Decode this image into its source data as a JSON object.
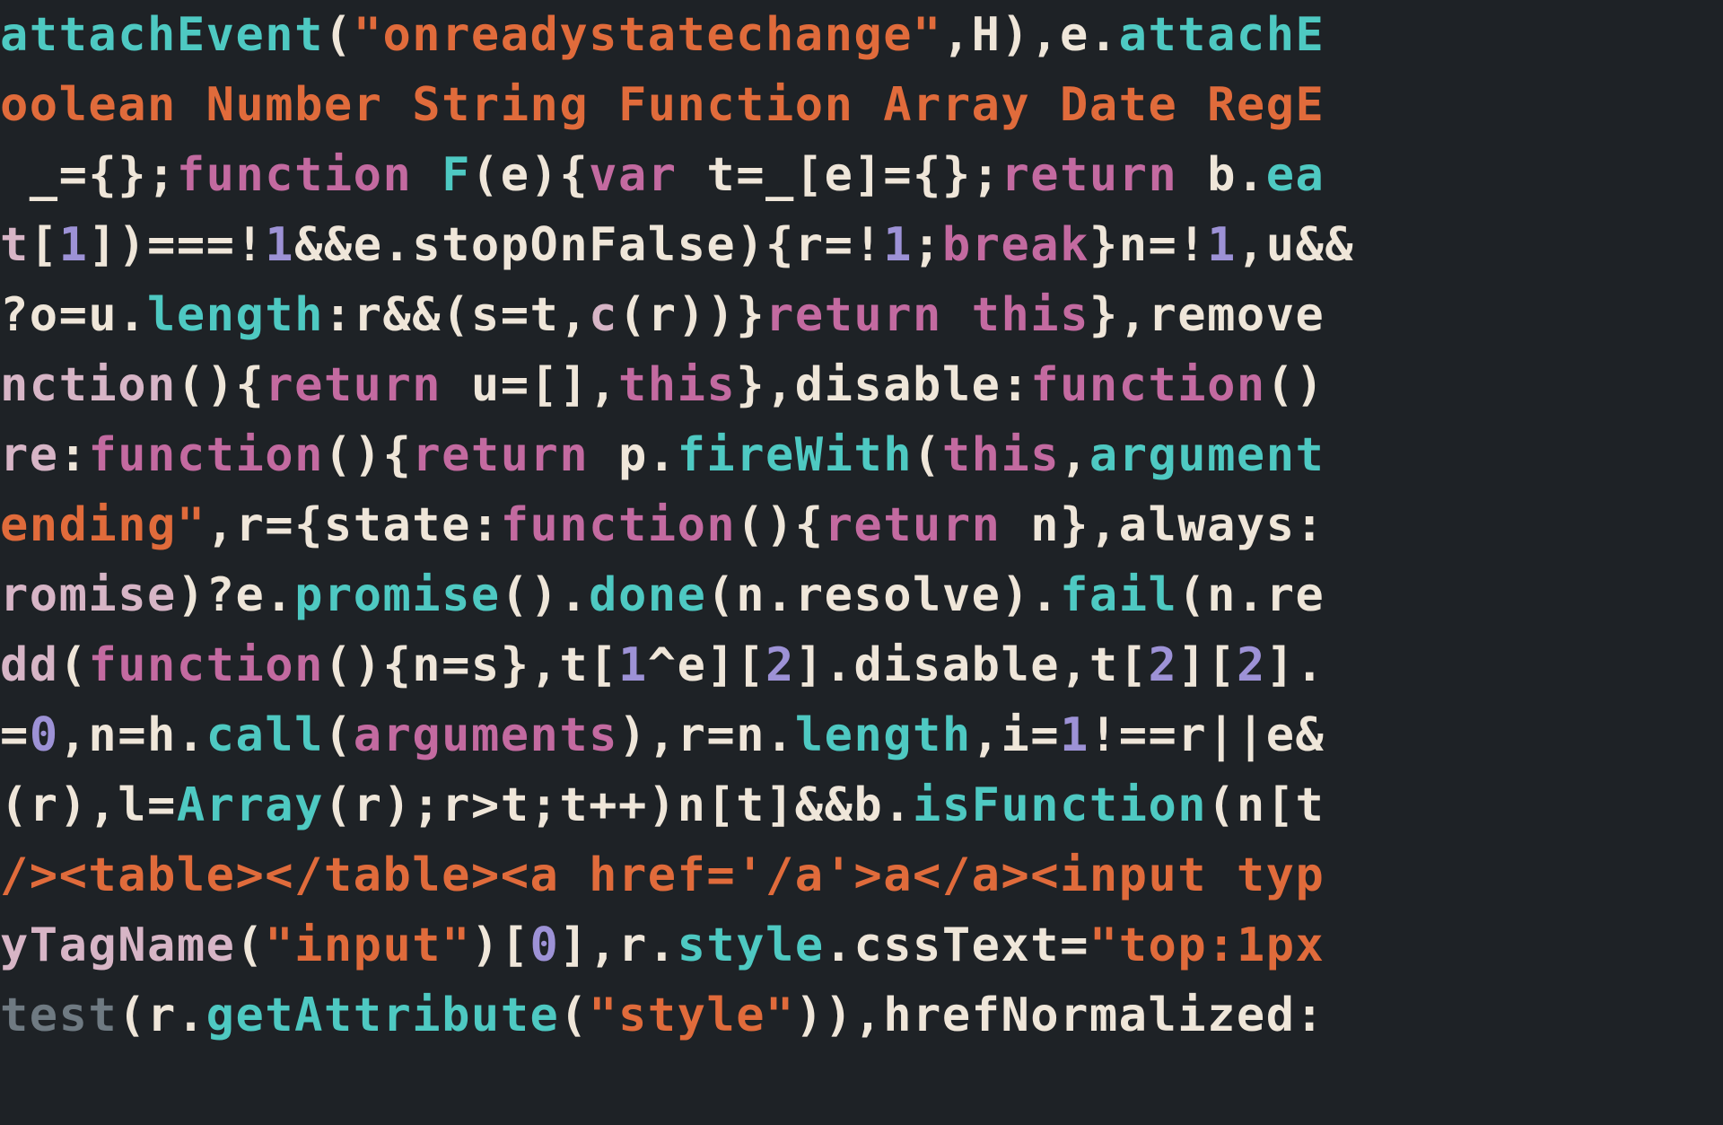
{
  "code": {
    "lines": [
      [
        {
          "c": "cyan",
          "t": "attachEvent"
        },
        {
          "c": "cream",
          "t": "("
        },
        {
          "c": "orange",
          "t": "\"onreadystatechange\""
        },
        {
          "c": "cream",
          "t": ",H),e."
        },
        {
          "c": "cyan",
          "t": "attachE"
        }
      ],
      [
        {
          "c": "orange",
          "t": "oolean Number String Function Array Date RegE"
        }
      ],
      [
        {
          "c": "cream",
          "t": " _={};"
        },
        {
          "c": "pink",
          "t": "function"
        },
        {
          "c": "cream",
          "t": " "
        },
        {
          "c": "cyan",
          "t": "F"
        },
        {
          "c": "cream",
          "t": "(e){"
        },
        {
          "c": "pink",
          "t": "var"
        },
        {
          "c": "cream",
          "t": " t=_[e]={};"
        },
        {
          "c": "pink",
          "t": "return"
        },
        {
          "c": "cream",
          "t": " b."
        },
        {
          "c": "cyan",
          "t": "ea"
        }
      ],
      [
        {
          "c": "mauve",
          "t": "t"
        },
        {
          "c": "cream",
          "t": "["
        },
        {
          "c": "purple",
          "t": "1"
        },
        {
          "c": "cream",
          "t": "])===!"
        },
        {
          "c": "purple",
          "t": "1"
        },
        {
          "c": "cream",
          "t": "&&e.stopOnFalse){r=!"
        },
        {
          "c": "purple",
          "t": "1"
        },
        {
          "c": "cream",
          "t": ";"
        },
        {
          "c": "pink",
          "t": "break"
        },
        {
          "c": "cream",
          "t": "}n=!"
        },
        {
          "c": "purple",
          "t": "1"
        },
        {
          "c": "cream",
          "t": ",u&&"
        }
      ],
      [
        {
          "c": "cream",
          "t": "?o=u."
        },
        {
          "c": "cyan",
          "t": "length"
        },
        {
          "c": "cream",
          "t": ":r&&(s=t,"
        },
        {
          "c": "mauve",
          "t": "c"
        },
        {
          "c": "cream",
          "t": "(r))}"
        },
        {
          "c": "pink",
          "t": "return this"
        },
        {
          "c": "cream",
          "t": "},remove"
        }
      ],
      [
        {
          "c": "mauve",
          "t": "nction"
        },
        {
          "c": "cream",
          "t": "(){"
        },
        {
          "c": "pink",
          "t": "return"
        },
        {
          "c": "cream",
          "t": " u=[],"
        },
        {
          "c": "pink",
          "t": "this"
        },
        {
          "c": "cream",
          "t": "},disable:"
        },
        {
          "c": "pink",
          "t": "function"
        },
        {
          "c": "cream",
          "t": "()"
        }
      ],
      [
        {
          "c": "mauve",
          "t": "re"
        },
        {
          "c": "cream",
          "t": ":"
        },
        {
          "c": "pink",
          "t": "function"
        },
        {
          "c": "cream",
          "t": "(){"
        },
        {
          "c": "pink",
          "t": "return"
        },
        {
          "c": "cream",
          "t": " p."
        },
        {
          "c": "cyan",
          "t": "fireWith"
        },
        {
          "c": "cream",
          "t": "("
        },
        {
          "c": "pink",
          "t": "this"
        },
        {
          "c": "cream",
          "t": ","
        },
        {
          "c": "cyan",
          "t": "argument"
        }
      ],
      [
        {
          "c": "orange",
          "t": "ending\""
        },
        {
          "c": "cream",
          "t": ",r={state:"
        },
        {
          "c": "pink",
          "t": "function"
        },
        {
          "c": "cream",
          "t": "(){"
        },
        {
          "c": "pink",
          "t": "return"
        },
        {
          "c": "cream",
          "t": " n},always:"
        }
      ],
      [
        {
          "c": "mauve",
          "t": "romise"
        },
        {
          "c": "cream",
          "t": ")?e."
        },
        {
          "c": "cyan",
          "t": "promise"
        },
        {
          "c": "cream",
          "t": "()."
        },
        {
          "c": "cyan",
          "t": "done"
        },
        {
          "c": "cream",
          "t": "(n.resolve)."
        },
        {
          "c": "cyan",
          "t": "fail"
        },
        {
          "c": "cream",
          "t": "(n.re"
        }
      ],
      [
        {
          "c": "mauve",
          "t": "dd"
        },
        {
          "c": "cream",
          "t": "("
        },
        {
          "c": "pink",
          "t": "function"
        },
        {
          "c": "cream",
          "t": "(){n=s},t["
        },
        {
          "c": "purple",
          "t": "1"
        },
        {
          "c": "cream",
          "t": "^e]["
        },
        {
          "c": "purple",
          "t": "2"
        },
        {
          "c": "cream",
          "t": "].disable,t["
        },
        {
          "c": "purple",
          "t": "2"
        },
        {
          "c": "cream",
          "t": "]["
        },
        {
          "c": "purple",
          "t": "2"
        },
        {
          "c": "cream",
          "t": "]."
        }
      ],
      [
        {
          "c": "cream",
          "t": "="
        },
        {
          "c": "purple",
          "t": "0"
        },
        {
          "c": "cream",
          "t": ",n=h."
        },
        {
          "c": "cyan",
          "t": "call"
        },
        {
          "c": "cream",
          "t": "("
        },
        {
          "c": "pink",
          "t": "arguments"
        },
        {
          "c": "cream",
          "t": "),r=n."
        },
        {
          "c": "cyan",
          "t": "length"
        },
        {
          "c": "cream",
          "t": ",i="
        },
        {
          "c": "purple",
          "t": "1"
        },
        {
          "c": "cream",
          "t": "!==r||e&"
        }
      ],
      [
        {
          "c": "cream",
          "t": "(r),l="
        },
        {
          "c": "cyan",
          "t": "Array"
        },
        {
          "c": "cream",
          "t": "(r);r>t;t++)n[t]&&b."
        },
        {
          "c": "cyan",
          "t": "isFunction"
        },
        {
          "c": "cream",
          "t": "(n[t"
        }
      ],
      [
        {
          "c": "orange",
          "t": "/><table></table><a href='/a'>a</a><input typ"
        }
      ],
      [
        {
          "c": "mauve",
          "t": "yTagName"
        },
        {
          "c": "cream",
          "t": "("
        },
        {
          "c": "orange",
          "t": "\"input\""
        },
        {
          "c": "cream",
          "t": ")["
        },
        {
          "c": "purple",
          "t": "0"
        },
        {
          "c": "cream",
          "t": "],r."
        },
        {
          "c": "cyan",
          "t": "style"
        },
        {
          "c": "cream",
          "t": ".cssText="
        },
        {
          "c": "orange",
          "t": "\"top:1px"
        }
      ],
      [
        {
          "c": "grey",
          "t": "test"
        },
        {
          "c": "cream",
          "t": "(r."
        },
        {
          "c": "cyan",
          "t": "getAttribute"
        },
        {
          "c": "cream",
          "t": "("
        },
        {
          "c": "orange",
          "t": "\"style\""
        },
        {
          "c": "cream",
          "t": ")),hrefNormalized:"
        }
      ]
    ]
  }
}
